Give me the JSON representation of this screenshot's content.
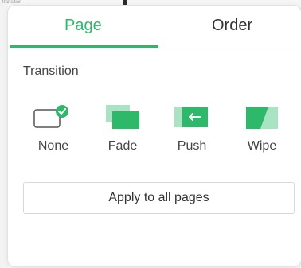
{
  "background": {
    "tab_label": "transition"
  },
  "tabs": [
    {
      "label": "Page",
      "active": true
    },
    {
      "label": "Order",
      "active": false
    }
  ],
  "section": {
    "title": "Transition"
  },
  "effects": [
    {
      "label": "None",
      "icon": "none-check-icon",
      "selected": true
    },
    {
      "label": "Fade",
      "icon": "fade-icon",
      "selected": false
    },
    {
      "label": "Push",
      "icon": "push-icon",
      "selected": false
    },
    {
      "label": "Wipe",
      "icon": "wipe-icon",
      "selected": false
    }
  ],
  "apply_button": {
    "label": "Apply to all pages"
  },
  "colors": {
    "accent": "#2db86a",
    "accent_light": "#a8e3c2",
    "text": "#333333"
  }
}
